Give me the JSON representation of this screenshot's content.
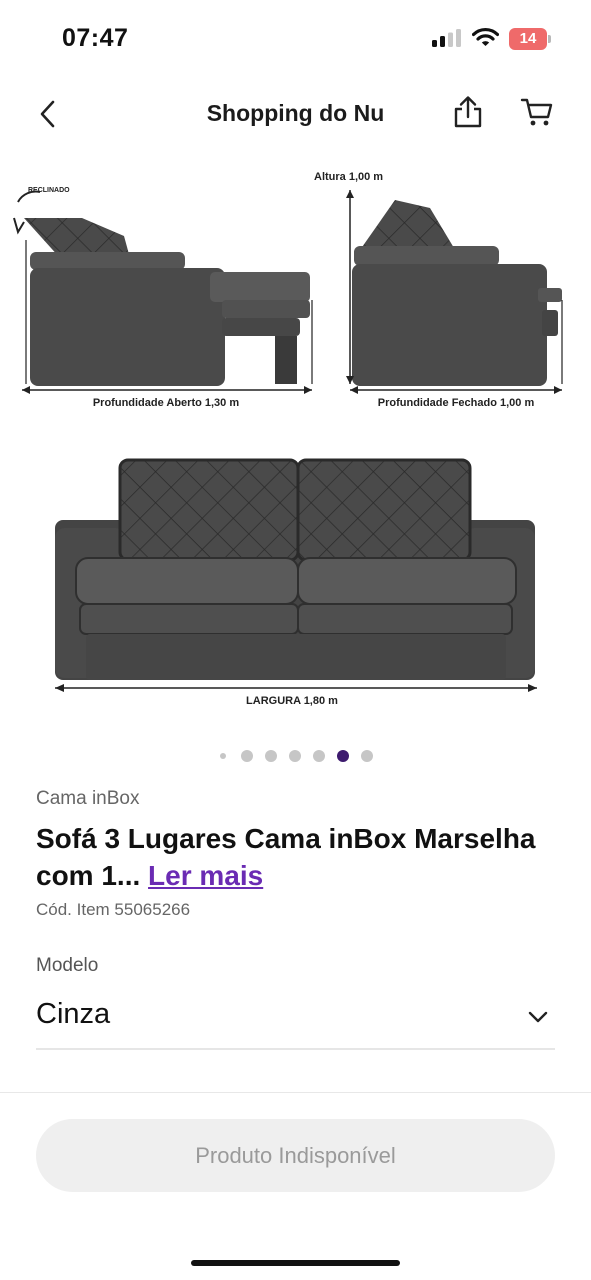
{
  "status_bar": {
    "time": "07:47",
    "battery_level": "14",
    "battery_color": "#ef6a6a",
    "icons": [
      "signal-icon",
      "wifi-icon",
      "battery-icon"
    ]
  },
  "header": {
    "title": "Shopping do Nu",
    "back_icon": "chevron-left-icon",
    "share_icon": "share-icon",
    "cart_icon": "cart-icon"
  },
  "gallery": {
    "image_labels": {
      "reclined": "RECLINADO",
      "height": "Altura 1,00 m",
      "depth_open": "Profundidade Aberto 1,30 m",
      "depth_closed": "Profundidade Fechado 1,00 m",
      "width": "LARGURA 1,80 m"
    },
    "dots_count": 7,
    "active_dot_index": 5,
    "accent_color": "#3d1a6e"
  },
  "product": {
    "brand": "Cama inBox",
    "title": "Sofá 3 Lugares Cama inBox Marselha com 1...",
    "read_more": "Ler mais",
    "item_code": "Cód. Item 55065266",
    "link_color": "#6a2bb3"
  },
  "variant": {
    "label": "Modelo",
    "selected": "Cinza",
    "chevron_icon": "chevron-down-icon"
  },
  "cta": {
    "label": "Produto Indisponível",
    "enabled": false
  }
}
